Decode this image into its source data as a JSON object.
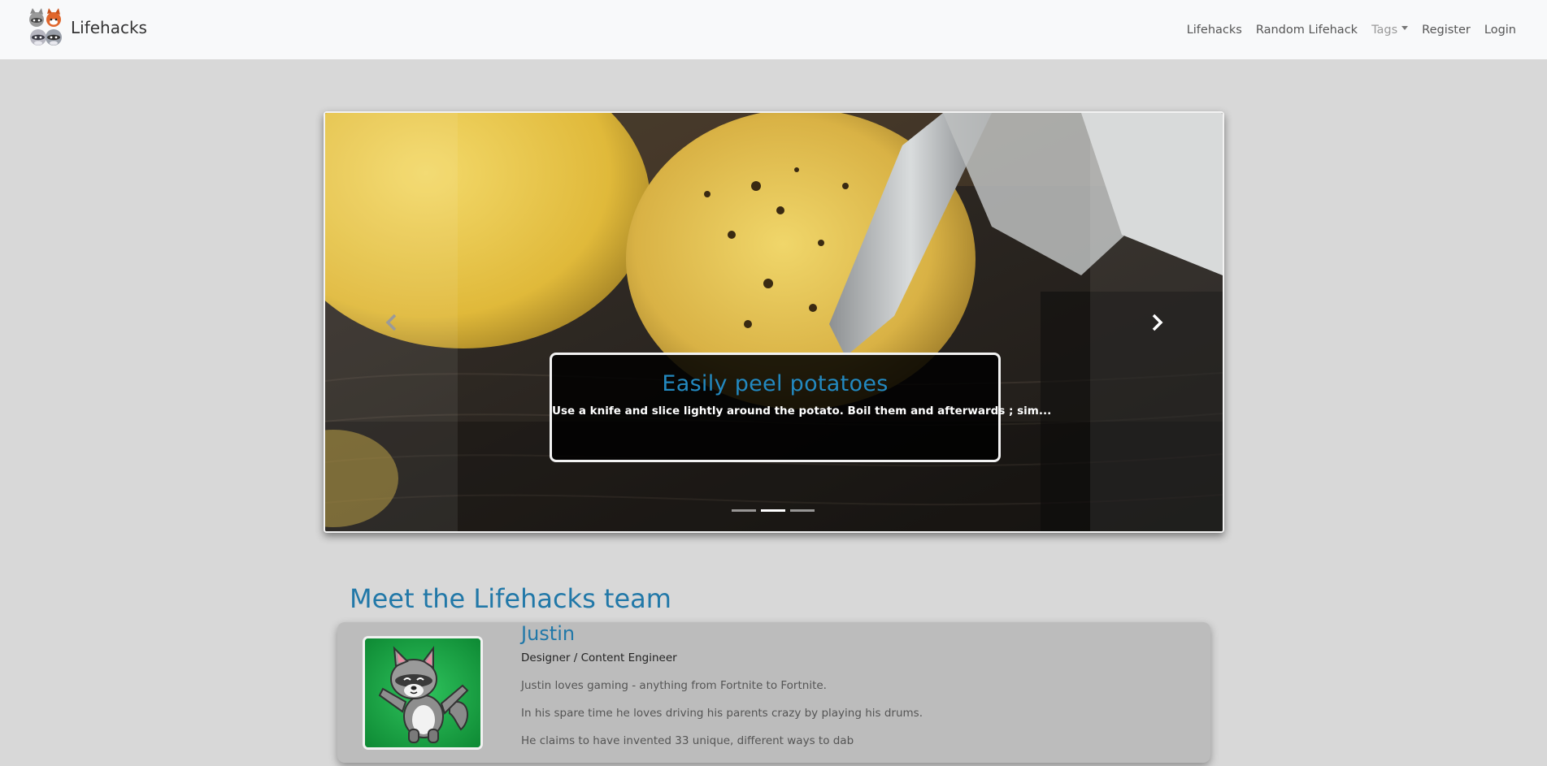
{
  "nav": {
    "brand": "Lifehacks",
    "links": {
      "lifehacks": "Lifehacks",
      "random": "Random Lifehack",
      "tags": "Tags",
      "register": "Register",
      "login": "Login"
    }
  },
  "carousel": {
    "active_slide": 2,
    "slide_count": 3,
    "caption_title": "Easily peel potatoes",
    "caption_text": "Use a knife and slice lightly around the potato. Boil them and afterwards ; sim..."
  },
  "team": {
    "heading": "Meet the Lifehacks team",
    "members": [
      {
        "name": "Justin",
        "role": "Designer / Content Engineer",
        "lines": [
          "Justin loves gaming - anything from Fortnite to Fortnite.",
          "In his spare time he loves driving his parents crazy by playing his drums.",
          "He claims to have invented 33 unique, different ways to dab"
        ]
      }
    ]
  },
  "colors": {
    "accent": "#2178a8",
    "page_bg": "#d8d8d8",
    "navbar_bg": "#f8f9fa",
    "card_bg": "#bcbcbc"
  },
  "icons": {
    "brand": "raccoon-group-logo",
    "prev": "chevron-left-icon",
    "next": "chevron-right-icon",
    "tags_dropdown": "caret-down-icon",
    "avatar": "dabbing-raccoon-avatar"
  }
}
